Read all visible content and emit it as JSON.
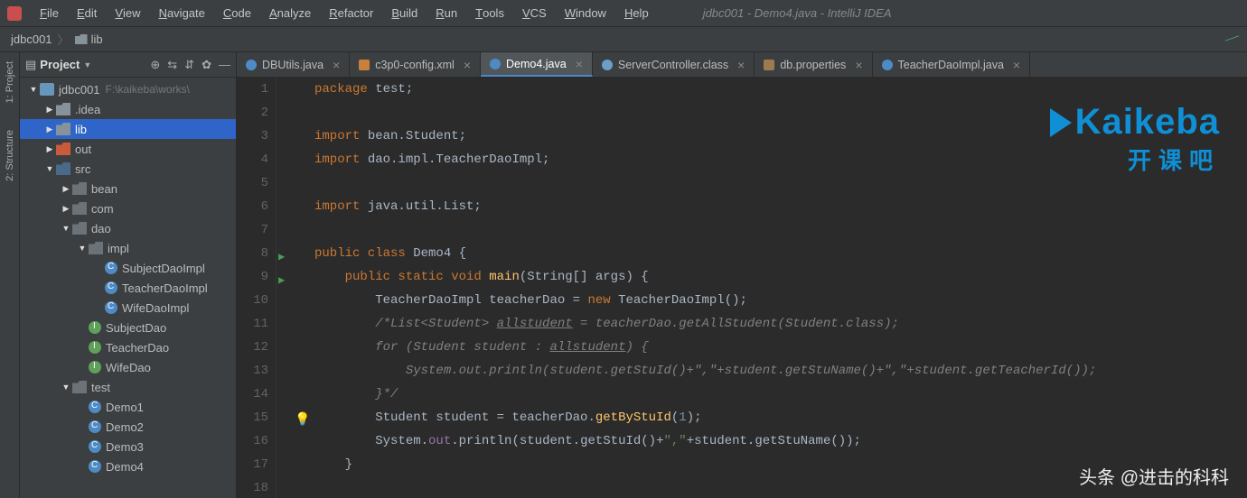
{
  "window": {
    "title": "jdbc001 - Demo4.java - IntelliJ IDEA"
  },
  "menu": [
    "File",
    "Edit",
    "View",
    "Navigate",
    "Code",
    "Analyze",
    "Refactor",
    "Build",
    "Run",
    "Tools",
    "VCS",
    "Window",
    "Help"
  ],
  "breadcrumb": {
    "project": "jdbc001",
    "folder": "lib"
  },
  "sidebar": {
    "title": "Project",
    "tree": [
      {
        "indent": 0,
        "arrow": "▼",
        "icon": "module",
        "label": "jdbc001",
        "path": "F:\\kaikeba\\works\\"
      },
      {
        "indent": 1,
        "arrow": "▶",
        "icon": "folder",
        "label": ".idea"
      },
      {
        "indent": 1,
        "arrow": "▶",
        "icon": "folder",
        "label": "lib",
        "selected": true
      },
      {
        "indent": 1,
        "arrow": "▶",
        "icon": "folder-red",
        "label": "out"
      },
      {
        "indent": 1,
        "arrow": "▼",
        "icon": "folder-blue",
        "label": "src"
      },
      {
        "indent": 2,
        "arrow": "▶",
        "icon": "package",
        "label": "bean"
      },
      {
        "indent": 2,
        "arrow": "▶",
        "icon": "package",
        "label": "com"
      },
      {
        "indent": 2,
        "arrow": "▼",
        "icon": "package",
        "label": "dao"
      },
      {
        "indent": 3,
        "arrow": "▼",
        "icon": "package",
        "label": "impl"
      },
      {
        "indent": 4,
        "arrow": "",
        "icon": "class",
        "label": "SubjectDaoImpl"
      },
      {
        "indent": 4,
        "arrow": "",
        "icon": "class",
        "label": "TeacherDaoImpl"
      },
      {
        "indent": 4,
        "arrow": "",
        "icon": "class",
        "label": "WifeDaoImpl"
      },
      {
        "indent": 3,
        "arrow": "",
        "icon": "interface",
        "label": "SubjectDao"
      },
      {
        "indent": 3,
        "arrow": "",
        "icon": "interface",
        "label": "TeacherDao"
      },
      {
        "indent": 3,
        "arrow": "",
        "icon": "interface",
        "label": "WifeDao"
      },
      {
        "indent": 2,
        "arrow": "▼",
        "icon": "package",
        "label": "test"
      },
      {
        "indent": 3,
        "arrow": "",
        "icon": "class",
        "label": "Demo1"
      },
      {
        "indent": 3,
        "arrow": "",
        "icon": "class",
        "label": "Demo2"
      },
      {
        "indent": 3,
        "arrow": "",
        "icon": "class",
        "label": "Demo3"
      },
      {
        "indent": 3,
        "arrow": "",
        "icon": "class",
        "label": "Demo4"
      }
    ]
  },
  "tabs": [
    {
      "icon": "java",
      "label": "DBUtils.java"
    },
    {
      "icon": "xml",
      "label": "c3p0-config.xml"
    },
    {
      "icon": "java",
      "label": "Demo4.java",
      "active": true
    },
    {
      "icon": "class",
      "label": "ServerController.class"
    },
    {
      "icon": "props",
      "label": "db.properties"
    },
    {
      "icon": "java",
      "label": "TeacherDaoImpl.java"
    }
  ],
  "editor": {
    "lines": [
      1,
      2,
      3,
      4,
      5,
      6,
      7,
      8,
      9,
      10,
      11,
      12,
      13,
      14,
      15,
      16,
      17,
      18
    ],
    "run_markers": [
      8,
      9
    ],
    "bulb_line": 15,
    "code": {
      "l1": {
        "pre": "",
        "tokens": [
          {
            "c": "kw",
            "t": "package "
          },
          {
            "c": "id",
            "t": "test;"
          }
        ]
      },
      "l2": {
        "pre": "",
        "tokens": []
      },
      "l3": {
        "pre": "",
        "tokens": [
          {
            "c": "kw",
            "t": "import "
          },
          {
            "c": "id",
            "t": "bean.Student;"
          }
        ]
      },
      "l4": {
        "pre": "",
        "tokens": [
          {
            "c": "kw",
            "t": "import "
          },
          {
            "c": "id",
            "t": "dao.impl.TeacherDaoImpl;"
          }
        ]
      },
      "l5": {
        "pre": "",
        "tokens": []
      },
      "l6": {
        "pre": "",
        "tokens": [
          {
            "c": "kw",
            "t": "import "
          },
          {
            "c": "id",
            "t": "java.util.List;"
          }
        ]
      },
      "l7": {
        "pre": "",
        "tokens": []
      },
      "l8": {
        "pre": "",
        "tokens": [
          {
            "c": "kw",
            "t": "public class "
          },
          {
            "c": "id",
            "t": "Demo4 {"
          }
        ]
      },
      "l9": {
        "pre": "    ",
        "tokens": [
          {
            "c": "kw",
            "t": "public static void "
          },
          {
            "c": "mth",
            "t": "main"
          },
          {
            "c": "id",
            "t": "(String[] args) {"
          }
        ]
      },
      "l10": {
        "pre": "        ",
        "tokens": [
          {
            "c": "id",
            "t": "TeacherDaoImpl teacherDao = "
          },
          {
            "c": "kw",
            "t": "new "
          },
          {
            "c": "id",
            "t": "TeacherDaoImpl();"
          }
        ]
      },
      "l11": {
        "pre": "        ",
        "tokens": [
          {
            "c": "com",
            "t": "/*List<Student> "
          },
          {
            "c": "com und",
            "t": "allstudent"
          },
          {
            "c": "com",
            "t": " = teacherDao.getAllStudent(Student.class);"
          }
        ]
      },
      "l12": {
        "pre": "        ",
        "tokens": [
          {
            "c": "com",
            "t": "for (Student student : "
          },
          {
            "c": "com und",
            "t": "allstudent"
          },
          {
            "c": "com",
            "t": ") {"
          }
        ]
      },
      "l13": {
        "pre": "            ",
        "tokens": [
          {
            "c": "com",
            "t": "System.out.println(student.getStuId()+\",\"+student.getStuName()+\",\"+student.getTeacherId());"
          }
        ]
      },
      "l14": {
        "pre": "        ",
        "tokens": [
          {
            "c": "com",
            "t": "}*/"
          }
        ]
      },
      "l15": {
        "pre": "        ",
        "tokens": [
          {
            "c": "id",
            "t": "Student student = teacherDao."
          },
          {
            "c": "mth",
            "t": "getByStuId"
          },
          {
            "c": "id",
            "t": "("
          },
          {
            "c": "num",
            "t": "1"
          },
          {
            "c": "id",
            "t": ");"
          }
        ]
      },
      "l16": {
        "pre": "        ",
        "tokens": [
          {
            "c": "id",
            "t": "System."
          },
          {
            "c": "fld",
            "t": "out"
          },
          {
            "c": "id",
            "t": ".println(student.getStuId()+"
          },
          {
            "c": "str",
            "t": "\",\""
          },
          {
            "c": "id",
            "t": "+student.getStuName());"
          }
        ]
      },
      "l17": {
        "pre": "    ",
        "tokens": [
          {
            "c": "id",
            "t": "}"
          }
        ]
      },
      "l18": {
        "pre": "",
        "tokens": []
      }
    }
  },
  "toolstrip": {
    "project": "1: Project",
    "structure": "2: Structure"
  },
  "logo": {
    "main": "aikeba",
    "sub": "开课吧"
  },
  "watermark": "头条 @进击的科科"
}
